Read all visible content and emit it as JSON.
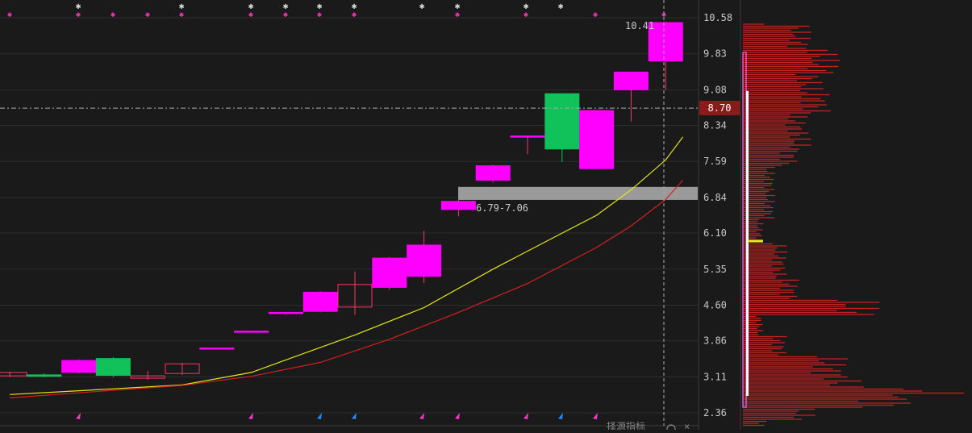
{
  "chart_data": {
    "type": "candlestick",
    "price_axis": {
      "ticks": [
        "10.58",
        "9.83",
        "9.08",
        "8.34",
        "7.59",
        "6.84",
        "6.10",
        "5.35",
        "4.60",
        "3.86",
        "3.11",
        "2.36"
      ],
      "range": [
        2.36,
        10.58
      ]
    },
    "current_price": {
      "label": "8.70",
      "value": 8.7
    },
    "high_label": "10.41",
    "zone_label": "6.79-7.06",
    "zone": {
      "low": 6.79,
      "high": 7.06
    },
    "candles": [
      {
        "open": 3.13,
        "close": 3.2,
        "high": 3.22,
        "low": 3.1
      },
      {
        "open": 3.15,
        "close": 3.12,
        "high": 3.18,
        "low": 3.1
      },
      {
        "open": 3.2,
        "close": 3.45,
        "high": 3.47,
        "low": 3.18
      },
      {
        "open": 3.49,
        "close": 3.14,
        "high": 3.52,
        "low": 3.1
      },
      {
        "open": 3.08,
        "close": 3.13,
        "high": 3.23,
        "low": 3.05
      },
      {
        "open": 3.18,
        "close": 3.38,
        "high": 3.4,
        "low": 3.15
      },
      {
        "open": 3.7,
        "close": 3.71,
        "high": 3.71,
        "low": 3.7
      },
      {
        "open": 4.05,
        "close": 4.06,
        "high": 4.06,
        "low": 4.05
      },
      {
        "open": 4.45,
        "close": 4.45,
        "high": 4.45,
        "low": 4.4
      },
      {
        "open": 4.47,
        "close": 4.87,
        "high": 4.89,
        "low": 4.45
      },
      {
        "open": 4.56,
        "close": 5.03,
        "high": 5.3,
        "low": 4.4
      },
      {
        "open": 4.97,
        "close": 5.58,
        "high": 5.6,
        "low": 4.92
      },
      {
        "open": 5.2,
        "close": 5.85,
        "high": 6.15,
        "low": 5.06
      },
      {
        "open": 6.59,
        "close": 6.76,
        "high": 6.8,
        "low": 6.45
      },
      {
        "open": 7.2,
        "close": 7.5,
        "high": 7.52,
        "low": 7.15
      },
      {
        "open": 8.1,
        "close": 8.12,
        "high": 8.12,
        "low": 7.74
      },
      {
        "open": 9.0,
        "close": 7.85,
        "high": 9.0,
        "low": 7.58
      },
      {
        "open": 7.44,
        "close": 8.65,
        "high": 8.65,
        "low": 7.44
      },
      {
        "open": 9.08,
        "close": 9.45,
        "high": 9.46,
        "low": 8.42
      },
      {
        "open": 9.68,
        "close": 10.48,
        "high": 10.5,
        "low": 9.08
      }
    ],
    "ma_yellow": [
      [
        0,
        2.74
      ],
      [
        2,
        2.82
      ],
      [
        5,
        2.94
      ],
      [
        7,
        3.2
      ],
      [
        10,
        3.98
      ],
      [
        12,
        4.55
      ],
      [
        14,
        5.35
      ],
      [
        16,
        6.1
      ],
      [
        17,
        6.47
      ],
      [
        18,
        7.0
      ],
      [
        19,
        7.62
      ],
      [
        19.5,
        8.1
      ]
    ],
    "ma_red": [
      [
        0,
        2.67
      ],
      [
        3,
        2.83
      ],
      [
        5,
        2.93
      ],
      [
        7,
        3.12
      ],
      [
        9,
        3.41
      ],
      [
        11,
        3.89
      ],
      [
        13,
        4.45
      ],
      [
        15,
        5.05
      ],
      [
        17,
        5.8
      ],
      [
        18,
        6.25
      ],
      [
        19,
        6.8
      ],
      [
        19.5,
        7.2
      ]
    ]
  },
  "colors": {
    "bg": "#1a1a1a",
    "bull": "#ff00ff",
    "bear": "#11c15a",
    "wick_up": "#ff3366",
    "yellow_ma": "#e6e619",
    "red_ma": "#d42020",
    "grid": "#2e2e2e",
    "axis_text": "#c8c8c8",
    "price_box": "#8b1a1a",
    "volume_profile": "#cc2222"
  },
  "bottom_status": "择源指标",
  "icon_names": [
    "asterisk-marker-icon",
    "up-arrow-marker-icon",
    "close-icon",
    "settings-icon"
  ]
}
